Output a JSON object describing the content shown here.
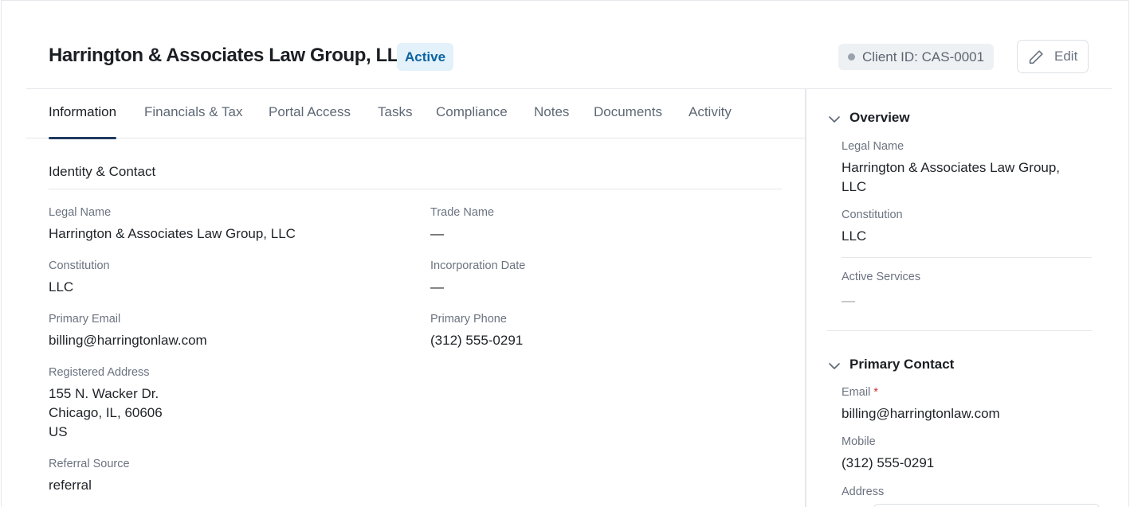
{
  "header": {
    "title": "Harrington & Associates Law Group, LLC",
    "status": "Active",
    "client_id": "Client ID: CAS-0001",
    "edit_label": "Edit"
  },
  "tabs": [
    {
      "label": "Information",
      "active": true
    },
    {
      "label": "Financials & Tax"
    },
    {
      "label": "Portal Access"
    },
    {
      "label": "Tasks"
    },
    {
      "label": "Compliance"
    },
    {
      "label": "Notes"
    },
    {
      "label": "Documents"
    },
    {
      "label": "Activity"
    }
  ],
  "identity": {
    "title": "Identity & Contact",
    "legal_name_label": "Legal Name",
    "legal_name": "Harrington & Associates Law Group, LLC",
    "trade_name_label": "Trade Name",
    "trade_name": "—",
    "constitution_label": "Constitution",
    "constitution": "LLC",
    "incorporation_label": "Incorporation Date",
    "incorporation": "—",
    "email_label": "Primary Email",
    "email": "billing@harringtonlaw.com",
    "phone_label": "Primary Phone",
    "phone": "(312) 555-0291",
    "address_label": "Registered Address",
    "address_line1": "155 N. Wacker Dr.",
    "address_line2": "Chicago, IL, 60606",
    "address_line3": "US",
    "referral_label": "Referral Source",
    "referral": "referral"
  },
  "overview": {
    "heading": "Overview",
    "legal_name_label": "Legal Name",
    "legal_name_line1": "Harrington & Associates Law Group,",
    "legal_name_line2": "LLC",
    "constitution_label": "Constitution",
    "constitution": "LLC",
    "services_label": "Active Services",
    "services": "—"
  },
  "primary_contact": {
    "heading": "Primary Contact",
    "email_label": "Email",
    "required_mark": "*",
    "email": "billing@harringtonlaw.com",
    "mobile_label": "Mobile",
    "mobile": "(312) 555-0291",
    "address_label": "Address"
  },
  "colors": {
    "accent": "#1e3a5f",
    "badge_bg": "#e3f1fb",
    "badge_text": "#0b63a1",
    "required": "#d32f2f"
  },
  "icons": [
    "pencil-icon",
    "chevron-down-icon"
  ]
}
